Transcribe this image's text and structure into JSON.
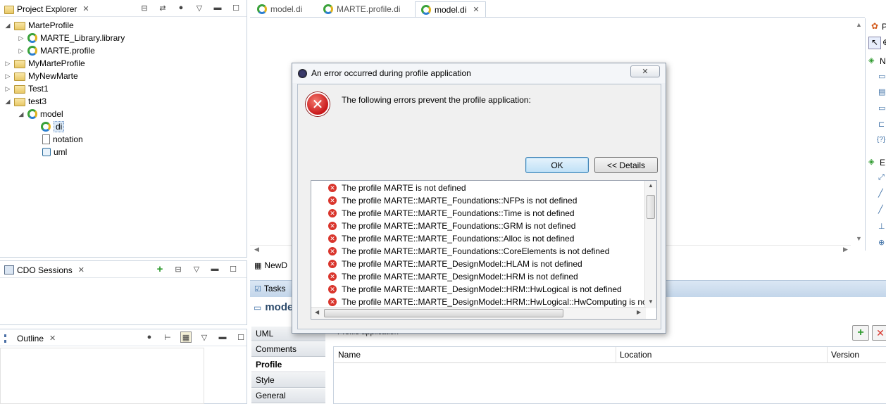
{
  "project_explorer": {
    "title": "Project Explorer",
    "tree": [
      {
        "label": "MarteProfile",
        "twisty": "◢",
        "icon": "folder-icon",
        "depth": 0
      },
      {
        "label": "MARTE_Library.library",
        "twisty": "▷",
        "icon": "papyrus-icon",
        "depth": 1
      },
      {
        "label": "MARTE.profile",
        "twisty": "▷",
        "icon": "papyrus-icon",
        "depth": 1
      },
      {
        "label": "MyMarteProfile",
        "twisty": "▷",
        "icon": "folder-icon",
        "depth": 0
      },
      {
        "label": "MyNewMarte",
        "twisty": "▷",
        "icon": "folder-icon",
        "depth": 0
      },
      {
        "label": "Test1",
        "twisty": "▷",
        "icon": "folder-icon",
        "depth": 0
      },
      {
        "label": "test3",
        "twisty": "◢",
        "icon": "folder-icon",
        "depth": 0
      },
      {
        "label": "model",
        "twisty": "◢",
        "icon": "papyrus-icon",
        "depth": 1
      },
      {
        "label": "di",
        "twisty": "",
        "icon": "papyrus-icon",
        "depth": 2
      },
      {
        "label": "notation",
        "twisty": "",
        "icon": "file-icon",
        "depth": 2
      },
      {
        "label": "uml",
        "twisty": "",
        "icon": "uml-icon",
        "depth": 2
      }
    ]
  },
  "cdo_sessions": {
    "title": "CDO Sessions"
  },
  "outline": {
    "title": "Outline"
  },
  "editor_tabs": [
    {
      "label": "model.di",
      "active": false
    },
    {
      "label": "MARTE.profile.di",
      "active": false
    },
    {
      "label": "model.di",
      "active": true
    }
  ],
  "palette": {
    "header": "P",
    "groups": [
      "N",
      "E"
    ]
  },
  "bottom": {
    "newd_label": "NewD",
    "tasks_label": "Tasks",
    "model_label": "mode",
    "side_tabs": [
      "UML",
      "Comments",
      "Profile",
      "Style",
      "General"
    ],
    "active_side_tab": "Profile",
    "profile_application_label": "Profile application",
    "table_headers": [
      "Name",
      "Location",
      "Version"
    ]
  },
  "dialog": {
    "title": "An error occurred during profile application",
    "message": "The following errors prevent the profile application:",
    "ok_label": "OK",
    "details_label": "<< Details",
    "close_glyph": "✕",
    "errors": [
      "The profile MARTE is not defined",
      "The profile MARTE::MARTE_Foundations::NFPs is not defined",
      "The profile MARTE::MARTE_Foundations::Time is not defined",
      "The profile MARTE::MARTE_Foundations::GRM is not defined",
      "The profile MARTE::MARTE_Foundations::Alloc is not defined",
      "The profile MARTE::MARTE_Foundations::CoreElements is not defined",
      "The profile MARTE::MARTE_DesignModel::HLAM is not defined",
      "The profile MARTE::MARTE_DesignModel::HRM is not defined",
      "The profile MARTE::MARTE_DesignModel::HRM::HwLogical is not defined",
      "The profile MARTE::MARTE_DesignModel::HRM::HwLogical::HwComputing is not"
    ]
  },
  "colors": {
    "error_red": "#d9342b",
    "accent_blue": "#3c7fb1",
    "border": "#c9d3df"
  }
}
